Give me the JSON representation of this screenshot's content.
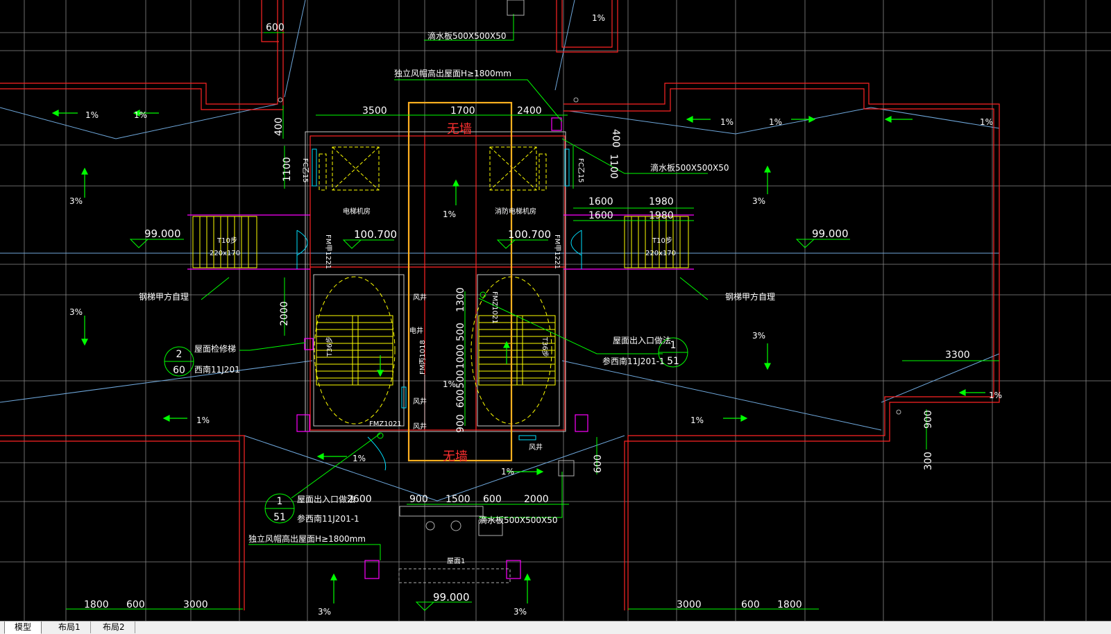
{
  "tabs": [
    {
      "label": "模型",
      "active": true
    },
    {
      "label": "布局1",
      "active": false
    },
    {
      "label": "布局2",
      "active": false
    }
  ],
  "notes": {
    "drip_plate": "滴水板500X500X50",
    "vent_cap": "独立风帽高出屋面H≥1800mm",
    "no_wall": "无墙",
    "elevator_room": "电梯机房",
    "fire_elevator_room": "消防电梯机房",
    "ladder_step": "T10步",
    "ladder_size": "220x170",
    "steel_ladder_left": "钢梯甲方自理",
    "steel_ladder_right": "钢梯甲方自理",
    "roof_repair_ladder": "屋面检修梯",
    "ref_xinan_j201": "西南11J201",
    "roof_exit": "屋面出入口做法",
    "ref_roof_exit": "参西南11J201-1",
    "roof_label": "屋面1",
    "stair_left": "T36步",
    "stair_right": "T36步",
    "fm_a": "FM甲1221",
    "fm_b": "FM甲1221",
    "fm_c": "FM丙1018",
    "fm_d": "FMZ1021",
    "fm_e": "FMZ1021",
    "fc": "FC乙15",
    "wind_shaft": "风井",
    "elec_shaft": "电井"
  },
  "slopes": {
    "one": "1%",
    "three": "3%"
  },
  "elevations": {
    "left": "99.000",
    "right": "99.000",
    "bottom": "99.000",
    "center_left": "100.700",
    "center_right": "100.700"
  },
  "dims": {
    "d600_top": "600",
    "d3500": "3500",
    "d1700": "1700",
    "d2400": "2400",
    "d400_left": "400",
    "d400_right": "400",
    "d1100_left": "1100",
    "d1100_right": "1100",
    "d1600_a": "1600",
    "d1980_a": "1980",
    "d1600_b": "1600",
    "d1980_b": "1980",
    "d2000_left": "2000",
    "d1300": "1300",
    "d500_a": "500",
    "d1000": "1000",
    "d500_b": "500",
    "d600_mid": "600",
    "d900_mid": "900",
    "d3300": "3300",
    "d900_right": "900",
    "d300_right": "300",
    "d600_lower": "600",
    "d2600": "2600",
    "d900_b": "900",
    "d1500": "1500",
    "d600_b": "600",
    "d2000_b": "2000",
    "d1800_l": "1800",
    "d600_l": "600",
    "d3000_l": "3000",
    "d3000_r": "3000",
    "d600_r": "600",
    "d1800_r": "1800"
  },
  "callouts": {
    "c1_top": "2",
    "c1_bottom": "60",
    "c2_top": "1",
    "c2_bottom": "51",
    "c3_top": "1",
    "c3_bottom": "51"
  },
  "colors": {
    "background": "#000000",
    "wall_red": "#ff2020",
    "dim_green": "#00ff00",
    "grid_gray": "#909090",
    "cyan": "#00e0ff",
    "magenta": "#ff00ff",
    "yellow": "#ffff00",
    "highlight_orange": "#ffb020",
    "blue_line": "#6fa8dc",
    "text_white": "#ffffff"
  }
}
